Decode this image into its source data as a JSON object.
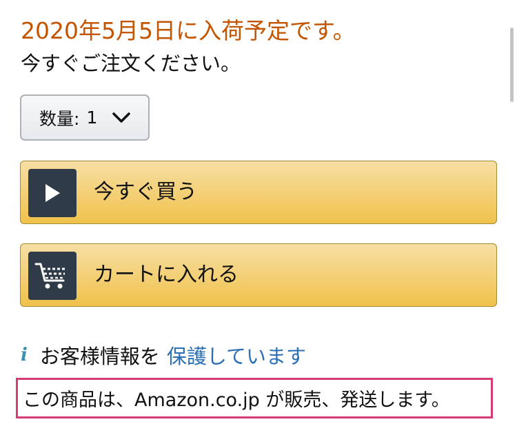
{
  "availability": {
    "date_text": "2020年5月5日に入荷予定です。",
    "order_text": "今すぐご注文ください。"
  },
  "quantity": {
    "label": "数量:",
    "value": "1"
  },
  "buttons": {
    "buy_now": "今すぐ買う",
    "add_to_cart": "カートに入れる"
  },
  "security": {
    "info_glyph": "i",
    "text": "お客様情報を",
    "link": "保護しています"
  },
  "seller": {
    "text": "この商品は、Amazon.co.jp が販売、発送します。"
  },
  "colors": {
    "availability": "#c45500",
    "button_top": "#f7dfa5",
    "button_bottom": "#f0c14b",
    "link": "#2a6fb6",
    "highlight_border": "#d63b76"
  },
  "icons": {
    "buy_now": "play-icon",
    "add_to_cart": "cart-icon",
    "quantity_dropdown": "chevron-down-icon",
    "security": "info-icon"
  }
}
